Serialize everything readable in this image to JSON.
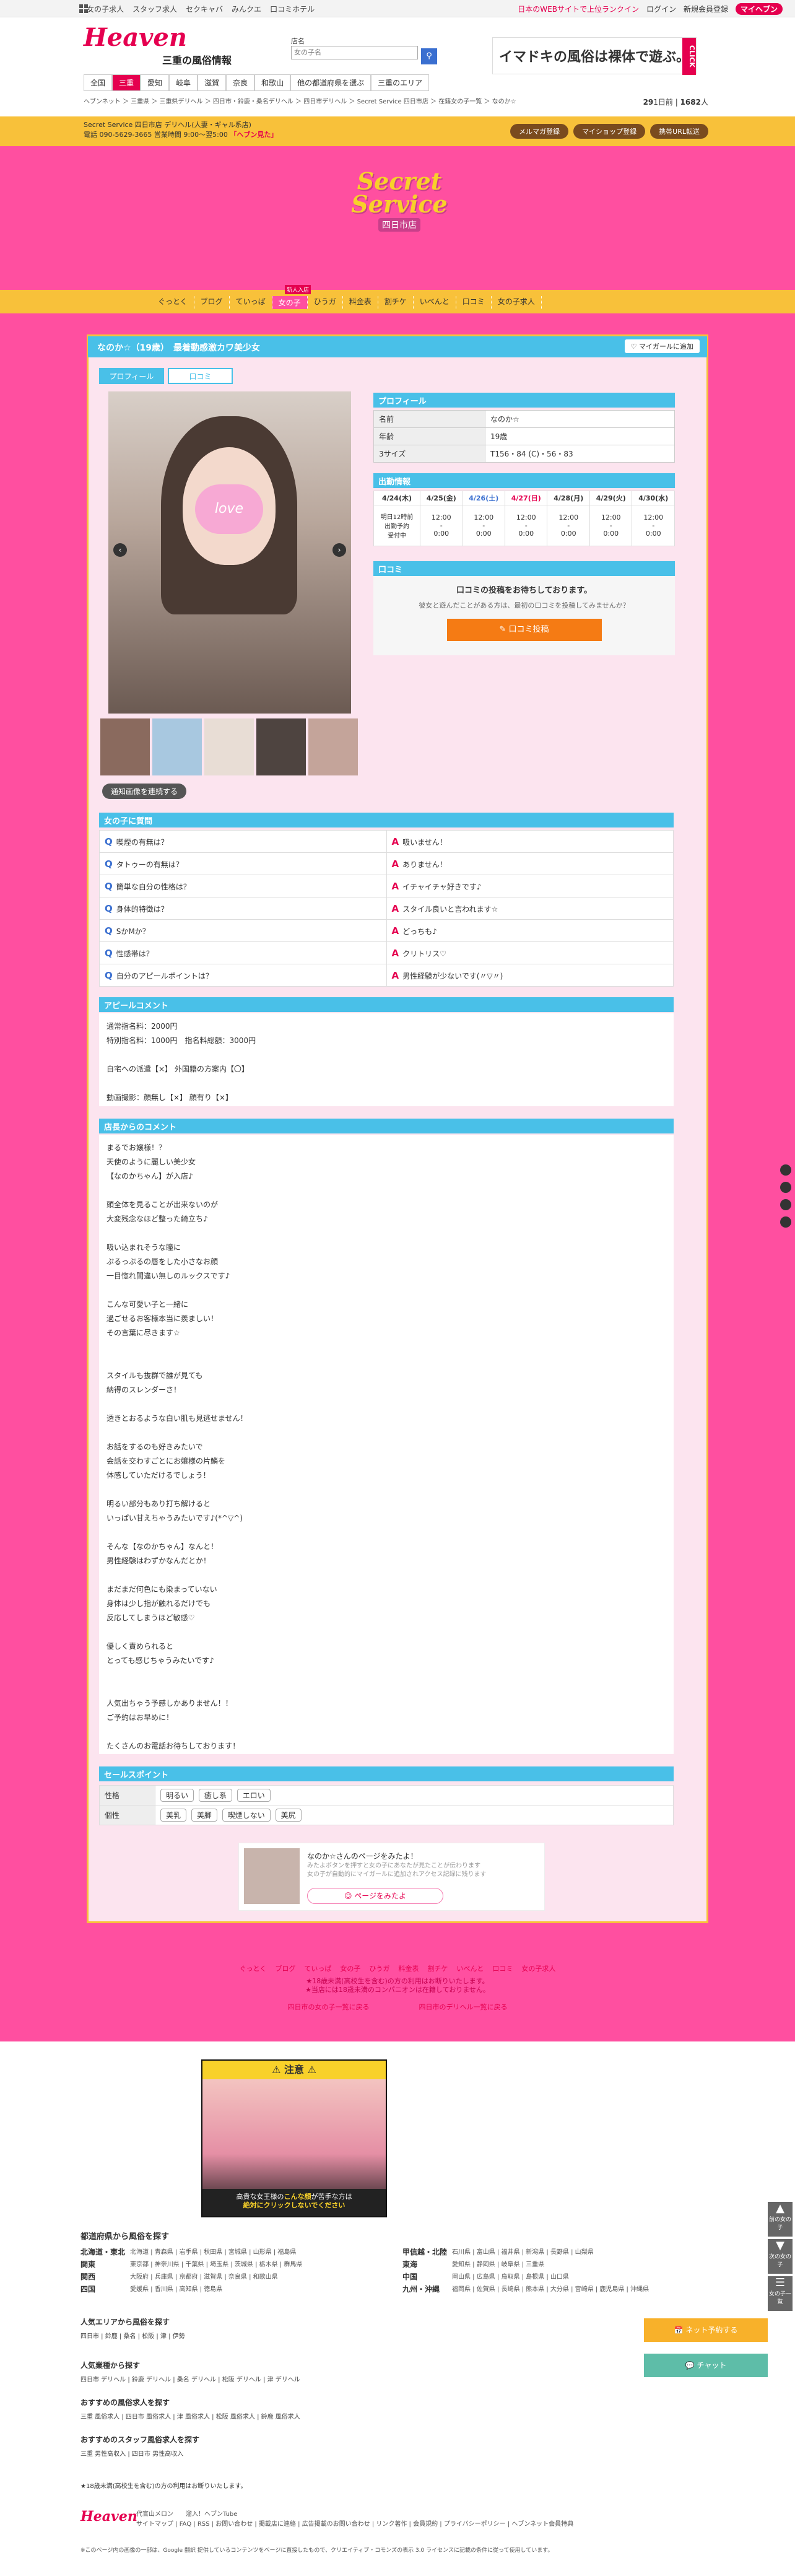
{
  "util": {
    "items": [
      "女の子求人",
      "スタッフ求人",
      "セクキャバ",
      "みんクエ",
      "口コミホテル"
    ],
    "right": [
      "日本のWEBサイトで上位ランクイン",
      "ログイン",
      "新規会員登録"
    ],
    "myheaven": "マイヘブン"
  },
  "header": {
    "logo": "Heaven",
    "logo_sub": "三重の風俗情報",
    "search_label": "店名",
    "search_placeholder": "女の子名",
    "ad_text": "イマドキの風俗は裸体で遊ぶ。",
    "ad_click": "CLICK"
  },
  "gnav": [
    "全国",
    "三重",
    "愛知",
    "岐阜",
    "滋賀",
    "奈良",
    "和歌山",
    "他の都道府県を選ぶ",
    "三重のエリア"
  ],
  "breadcrumb": "ヘブンネット ＞ 三重県 ＞ 三重県デリヘル ＞ 四日市・鈴鹿・桑名デリヘル ＞ 四日市デリヘル ＞ Secret Service 四日市店 ＞ 在籍女の子一覧 ＞ なのか☆",
  "counts": {
    "a": "29",
    "a_unit": "1日前",
    "b": "1682",
    "b_unit": "人"
  },
  "shopbar": {
    "line1": "Secret Service 四日市店 デリヘル(人妻・ギャル系店)",
    "line2": "電話 090-5629-3665 営業時間 9:00～翌5:00",
    "highlight": "「ヘブン見た」",
    "buttons": [
      "メルマガ登録",
      "マイショップ登録",
      "携帯URL転送"
    ]
  },
  "shop": {
    "logo1": "Secret",
    "logo2": "Service",
    "logo3": "四日市店",
    "newbadge": "新人入店",
    "nav": [
      "ぐっとく",
      "ブログ",
      "ていっぱ",
      "女の子",
      "ひうガ",
      "料金表",
      "割チケ",
      "いべんと",
      "口コミ",
      "女の子求人"
    ],
    "nav_on_index": 3
  },
  "girl": {
    "title": "なのか☆（19歳）　最着動感激カワ美少女",
    "fav_button": "マイガールに追加",
    "tabs": [
      "プロフィール",
      "口コミ"
    ],
    "photo_mark": "love",
    "diary_button": "通知画像を連続する"
  },
  "profile": {
    "header": "プロフィール",
    "rows": [
      {
        "k": "名前",
        "v": "なのか☆"
      },
      {
        "k": "年齢",
        "v": "19歳"
      },
      {
        "k": "3サイズ",
        "v": "T156・84 (C)・56・83"
      }
    ]
  },
  "schedule": {
    "header": "出勤情報",
    "days": [
      "4/24(木)",
      "4/25(金)",
      "4/26(土)",
      "4/27(日)",
      "4/28(月)",
      "4/29(火)",
      "4/30(水)"
    ],
    "row_label": "明日12時前\n出勤予約\n受付中",
    "times": [
      "12:00\n-\n0:00",
      "12:00\n-\n0:00",
      "12:00\n-\n0:00",
      "12:00\n-\n0:00",
      "12:00\n-\n0:00",
      "12:00\n-\n0:00"
    ]
  },
  "review": {
    "header": "口コミ",
    "lead": "口コミの投稿をお待ちしております。",
    "sub": "彼女と遊んだことがある方は、最初の口コミを投稿してみませんか？",
    "button": "口コミ投稿"
  },
  "qa": {
    "header": "女の子に質問",
    "rows": [
      {
        "q": "喫煙の有無は？",
        "a": "吸いません！"
      },
      {
        "q": "タトゥーの有無は？",
        "a": "ありません！"
      },
      {
        "q": "簡単な自分の性格は？",
        "a": "イチャイチャ好きです♪"
      },
      {
        "q": "身体的特徴は？",
        "a": "スタイル良いと言われます☆"
      },
      {
        "q": "SかMか？",
        "a": "どっちも♪"
      },
      {
        "q": "性感帯は？",
        "a": "クリトリス♡"
      },
      {
        "q": "自分のアピールポイントは？",
        "a": "男性経験が少ないです(〃▽〃)"
      }
    ]
  },
  "appeal": {
    "header": "アピールコメント",
    "text": "通常指名料：2000円\n特別指名料：1000円　指名料総額：3000円\n\n自宅への派遣【×】 外国籍の方案内【〇】\n\n動画撮影：顔無し【×】 顔有り【×】"
  },
  "shop_comment": {
    "header": "店長からのコメント",
    "text": "まるでお嬢様！？\n天使のように麗しい美少女\n【なのかちゃん】が入店♪\n\n頭全体を見ることが出来ないのが\n大変残念なほど整った綺立ち♪\n\n吸い込まれそうな瞳に\nぷるっぷるの唇をした小さなお顔\n一目惚れ間違い無しのルックスです♪\n\nこんな可愛い子と一緒に\n過ごせるお客様本当に羨ましい！\nその言葉に尽きます☆\n\n\nスタイルも抜群で誰が見ても\n納得のスレンダーさ！\n\n透きとおるような白い肌も見逃せません！\n\nお話をするのも好きみたいで\n会話を交わすごとにお嬢様の片鱗を\n体感していただけるでしょう！\n\n明るい部分もあり打ち解けると\nいっぱい甘えちゃうみたいです♪(*^▽^)\n\nそんな【なのかちゃん】なんと！\n男性経験はわずかなんだとか！\n\nまだまだ何色にも染まっていない\n身体は少し指が触れるだけでも\n反応してしまうほど敏感♡\n\n優しく責められると\nとっても感じちゃうみたいです♪\n\n\n人気出ちゃう予感しかありません！！\nご予約はお早めに！\n\nたくさんのお電話お待ちしております！"
  },
  "sales": {
    "header": "セールスポイント",
    "rows": [
      {
        "k": "性格",
        "chips": [
          "明るい",
          "癒し系",
          "エロい"
        ]
      },
      {
        "k": "個性",
        "chips": [
          "美乳",
          "美脚",
          "喫煙しない",
          "美尻"
        ]
      }
    ]
  },
  "mypage": {
    "t1": "なのか☆さんのページをみたよ！",
    "t2": "みたよボタンを押すと女の子にあなたが見たことが伝わります\n女の子が自動的にマイガールに追加されアクセス記録に残ります",
    "btn": "ページをみたよ"
  },
  "foot_nav": [
    "ぐっとく",
    "ブログ",
    "ていっぱ",
    "女の子",
    "ひうガ",
    "料金表",
    "割チケ",
    "いべんと",
    "口コミ",
    "女の子求人"
  ],
  "foot_notes": [
    "★18歳未満(高校生を含む)の方の利用はお断りいたします。",
    "★当店には18歳未満のコンパニオンは在籍しておりません。"
  ],
  "foot_links2": [
    "四日市の女の子一覧に戻る",
    "四日市のデリヘル一覧に戻る"
  ],
  "ad": {
    "warn": "注意",
    "bottom1": "高貴な女王様の",
    "bottom2": "こんな顔",
    "bottom3": "が苦手な方は",
    "bottom4": "絶対にクリックしないでください"
  },
  "area": {
    "header": "都道府県から風俗を探す",
    "rows": [
      {
        "r": "北海道・東北",
        "v": "北海道 | 青森県 | 岩手県 | 秋田県 | 宮城県 | 山形県 | 福島県"
      },
      {
        "r": "関東",
        "v": "東京都 | 神奈川県 | 千葉県 | 埼玉県 | 茨城県 | 栃木県 | 群馬県"
      },
      {
        "r": "関西",
        "v": "大阪府 | 兵庫県 | 京都府 | 滋賀県 | 奈良県 | 和歌山県"
      },
      {
        "r": "四国",
        "v": "愛媛県 | 香川県 | 高知県 | 徳島県"
      }
    ],
    "rows2": [
      {
        "r": "甲信越・北陸",
        "v": "石川県 | 富山県 | 福井県 | 新潟県 | 長野県 | 山梨県"
      },
      {
        "r": "東海",
        "v": "愛知県 | 静岡県 | 岐阜県 | 三重県"
      },
      {
        "r": "中国",
        "v": "岡山県 | 広島県 | 鳥取県 | 島根県 | 山口県"
      },
      {
        "r": "九州・沖縄",
        "v": "福岡県 | 佐賀県 | 長崎県 | 熊本県 | 大分県 | 宮崎県 | 鹿児島県 | 沖縄県"
      }
    ]
  },
  "footlists": [
    {
      "h": "人気エリアから風俗を探す",
      "v": "四日市 | 鈴鹿 | 桑名 | 松阪 | 津 | 伊勢"
    },
    {
      "h": "人気業種から探す",
      "v": "四日市 デリヘル | 鈴鹿 デリヘル | 桑名 デリヘル | 松阪 デリヘル | 津 デリヘル"
    },
    {
      "h": "おすすめの風俗求人を探す",
      "v": "三重 風俗求人 | 四日市 風俗求人 | 津 風俗求人 | 松阪 風俗求人 | 鈴鹿 風俗求人"
    },
    {
      "h": "おすすめのスタッフ風俗求人を探す",
      "v": "三重 男性高収入 | 四日市 男性高収入"
    }
  ],
  "footnote": "★18歳未満(高校生を含む)の方の利用はお断りいたします。",
  "footer": {
    "logo": "Heaven",
    "links": "サイトマップ | FAQ | RSS | お問い合わせ | 掲載店に連絡 | 広告掲載のお問い合わせ | リンク著作 | 会員規約 | プライバシーポリシー | ヘブンネット会員特典",
    "partners": "代官山メロン　　溜入！ヘブンTube",
    "copy": "※このページ内の画像の一部は、Google 翻訳 提供しているコンテンツをページに直接したもので、クリエイティブ・コモンズの表示 3.0 ライセンスに記載の条件に従って使用しています。"
  },
  "side": {
    "btn1": "前の女の子",
    "btn2": "次の女の子",
    "btn3": "女の子一覧",
    "chat1": "ネット予約する",
    "chat2": "チャット"
  }
}
